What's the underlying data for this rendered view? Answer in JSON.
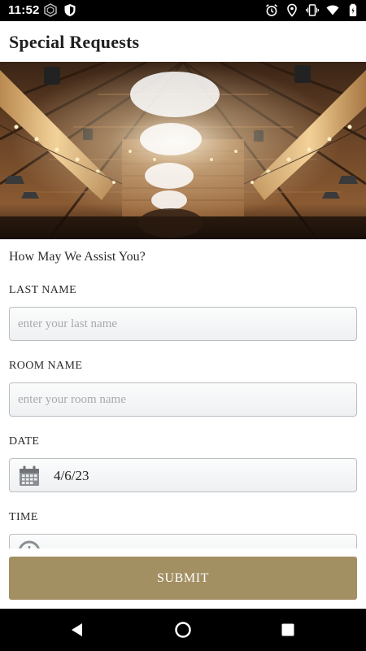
{
  "status_bar": {
    "time": "11:52",
    "left_icons": [
      "vpn-hexagon-icon",
      "shield-icon"
    ],
    "right_icons": [
      "alarm-icon",
      "location-icon",
      "vibrate-icon",
      "wifi-icon",
      "battery-icon"
    ]
  },
  "header": {
    "title": "Special Requests"
  },
  "hero": {
    "image": "chandelier-barn-icon"
  },
  "form": {
    "heading": "How May We Assist You?",
    "fields": [
      {
        "label": "LAST NAME",
        "placeholder": "enter your last name",
        "value": ""
      },
      {
        "label": "ROOM NAME",
        "placeholder": "enter your room name",
        "value": ""
      },
      {
        "label": "DATE",
        "value": "4/6/23",
        "icon": "calendar-icon"
      },
      {
        "label": "TIME",
        "value": "",
        "icon": "clock-icon"
      }
    ],
    "submit_label": "SUBMIT"
  },
  "nav_bar": {
    "buttons": [
      "back-icon",
      "home-icon",
      "recents-icon"
    ]
  },
  "colors": {
    "accent": "#a28f62",
    "field_border": "#b9bdc2",
    "placeholder": "#a7a9ac"
  }
}
